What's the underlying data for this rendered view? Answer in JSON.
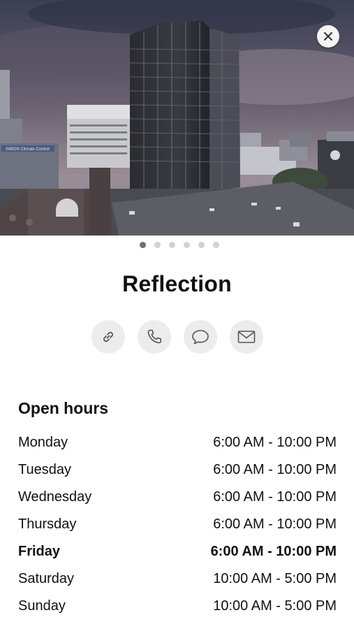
{
  "place": {
    "name": "Reflection"
  },
  "gallery": {
    "page_count": 6,
    "active_index": 0,
    "building_sign_text": "SIMON Climate Control"
  },
  "close_icon": "close-icon",
  "actions": [
    {
      "id": "website",
      "icon": "link-icon"
    },
    {
      "id": "call",
      "icon": "phone-icon"
    },
    {
      "id": "message",
      "icon": "message-bubble-icon"
    },
    {
      "id": "email",
      "icon": "envelope-icon"
    }
  ],
  "hours": {
    "heading": "Open hours",
    "days": [
      {
        "day": "Monday",
        "time": "6:00 AM - 10:00 PM",
        "current": false
      },
      {
        "day": "Tuesday",
        "time": "6:00 AM - 10:00 PM",
        "current": false
      },
      {
        "day": "Wednesday",
        "time": "6:00 AM - 10:00 PM",
        "current": false
      },
      {
        "day": "Thursday",
        "time": "6:00 AM - 10:00 PM",
        "current": false
      },
      {
        "day": "Friday",
        "time": "6:00 AM - 10:00 PM",
        "current": true
      },
      {
        "day": "Saturday",
        "time": "10:00 AM - 5:00 PM",
        "current": false
      },
      {
        "day": "Sunday",
        "time": "10:00 AM - 5:00 PM",
        "current": false
      }
    ]
  },
  "colors": {
    "button_bg": "#ececec",
    "icon_stroke": "#555555",
    "dot_active": "#6e6e6e",
    "dot_inactive": "#d2d2d2"
  }
}
